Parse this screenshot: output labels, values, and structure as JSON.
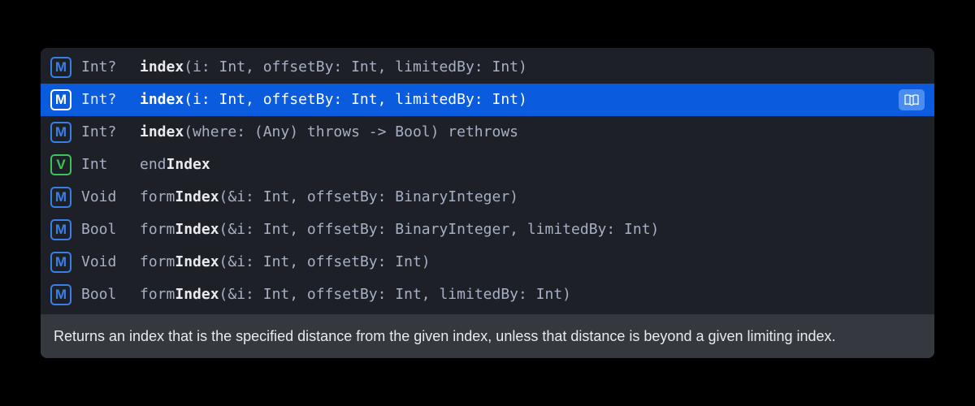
{
  "suggestions": [
    {
      "kind": "M",
      "kindClass": "kind-m",
      "returnType": "Int?",
      "selected": false,
      "prefix": "",
      "bold": "index",
      "suffix": "(i: Int, offsetBy: Int, limitedBy: Int)"
    },
    {
      "kind": "M",
      "kindClass": "kind-m",
      "returnType": "Int?",
      "selected": true,
      "prefix": "",
      "bold": "index",
      "suffix": "(i: Int, offsetBy: Int, limitedBy: Int)"
    },
    {
      "kind": "M",
      "kindClass": "kind-m",
      "returnType": "Int?",
      "selected": false,
      "prefix": "",
      "bold": "index",
      "suffix": "(where: (Any) throws -> Bool) rethrows"
    },
    {
      "kind": "V",
      "kindClass": "kind-v",
      "returnType": "Int",
      "selected": false,
      "prefix": "end",
      "bold": "Index",
      "suffix": ""
    },
    {
      "kind": "M",
      "kindClass": "kind-m",
      "returnType": "Void",
      "selected": false,
      "prefix": "form",
      "bold": "Index",
      "suffix": "(&i: Int, offsetBy: BinaryInteger)"
    },
    {
      "kind": "M",
      "kindClass": "kind-m",
      "returnType": "Bool",
      "selected": false,
      "prefix": "form",
      "bold": "Index",
      "suffix": "(&i: Int, offsetBy: BinaryInteger, limitedBy: Int)"
    },
    {
      "kind": "M",
      "kindClass": "kind-m",
      "returnType": "Void",
      "selected": false,
      "prefix": "form",
      "bold": "Index",
      "suffix": "(&i: Int, offsetBy: Int)"
    },
    {
      "kind": "M",
      "kindClass": "kind-m",
      "returnType": "Bool",
      "selected": false,
      "prefix": "form",
      "bold": "Index",
      "suffix": "(&i: Int, offsetBy: Int, limitedBy: Int)"
    }
  ],
  "summary": "Returns an index that is the specified distance from the given index, unless that distance is beyond a given limiting index."
}
